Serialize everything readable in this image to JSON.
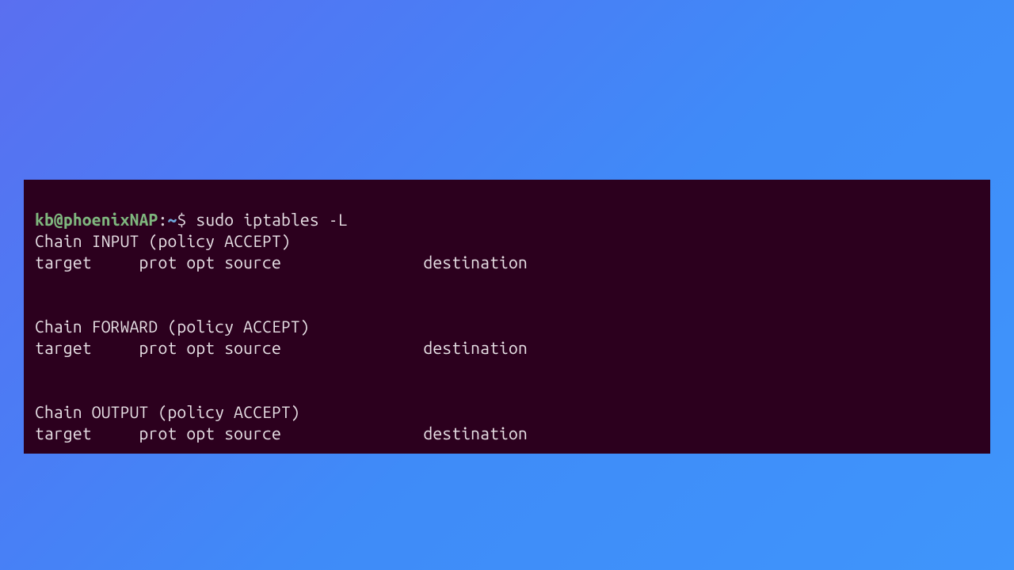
{
  "prompt": {
    "user": "kb",
    "at": "@",
    "host": "phoenixNAP",
    "colon": ":",
    "path": "~",
    "dollar": "$ ",
    "command": "sudo iptables -L"
  },
  "output": {
    "chain_input_header": "Chain INPUT (policy ACCEPT)",
    "chain_input_cols": "target     prot opt source               destination",
    "chain_forward_header": "Chain FORWARD (policy ACCEPT)",
    "chain_forward_cols": "target     prot opt source               destination",
    "chain_output_header": "Chain OUTPUT (policy ACCEPT)",
    "chain_output_cols": "target     prot opt source               destination"
  }
}
